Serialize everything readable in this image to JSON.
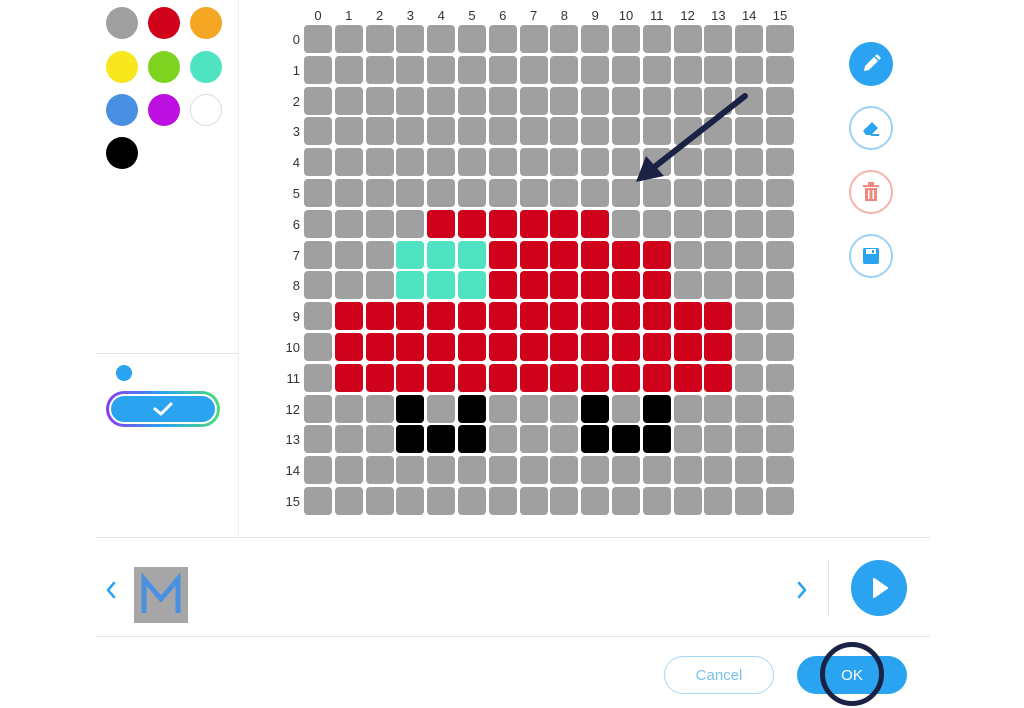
{
  "palette": [
    {
      "name": "gray",
      "color": "#a0a0a0"
    },
    {
      "name": "red",
      "color": "#d0021b"
    },
    {
      "name": "orange",
      "color": "#f5a623"
    },
    {
      "name": "yellow",
      "color": "#f8e71c"
    },
    {
      "name": "green",
      "color": "#7ed321"
    },
    {
      "name": "teal",
      "color": "#50e3c2"
    },
    {
      "name": "blue",
      "color": "#4a90e2"
    },
    {
      "name": "purple",
      "color": "#bd10e0"
    },
    {
      "name": "white",
      "color": "#ffffff"
    },
    {
      "name": "black",
      "color": "#000000"
    }
  ],
  "grid": {
    "columns": [
      "0",
      "1",
      "2",
      "3",
      "4",
      "5",
      "6",
      "7",
      "8",
      "9",
      "10",
      "11",
      "12",
      "13",
      "14",
      "15"
    ],
    "rows": [
      "0",
      "1",
      "2",
      "3",
      "4",
      "5",
      "6",
      "7",
      "8",
      "9",
      "10",
      "11",
      "12",
      "13",
      "14",
      "15"
    ],
    "colors": {
      "g": "#a0a0a0",
      "r": "#d0021b",
      "t": "#50e3c2",
      "k": "#000000"
    },
    "pixels": [
      "gggggggggggggggg",
      "gggggggggggggggg",
      "gggggggggggggggg",
      "gggggggggggggggg",
      "gggggggggggggggg",
      "gggggggggggggggg",
      "ggggrrrrrrgggggg",
      "gggtttrrrrrrgggg",
      "gggtttrrrrrrgggg",
      "grrrrrrrrrrrrrgg",
      "grrrrrrrrrrrrrgg",
      "grrrrrrrrrrrrrgg",
      "gggkgkgggkgkgggg",
      "gggkkkgggkkkgggg",
      "gggggggggggggggg",
      "gggggggggggggggg"
    ]
  },
  "tools": [
    "pencil-icon",
    "eraser-icon",
    "trash-icon",
    "save-icon"
  ],
  "footer": {
    "cancel_label": "Cancel",
    "ok_label": "OK"
  },
  "accent": "#2aa3f0"
}
